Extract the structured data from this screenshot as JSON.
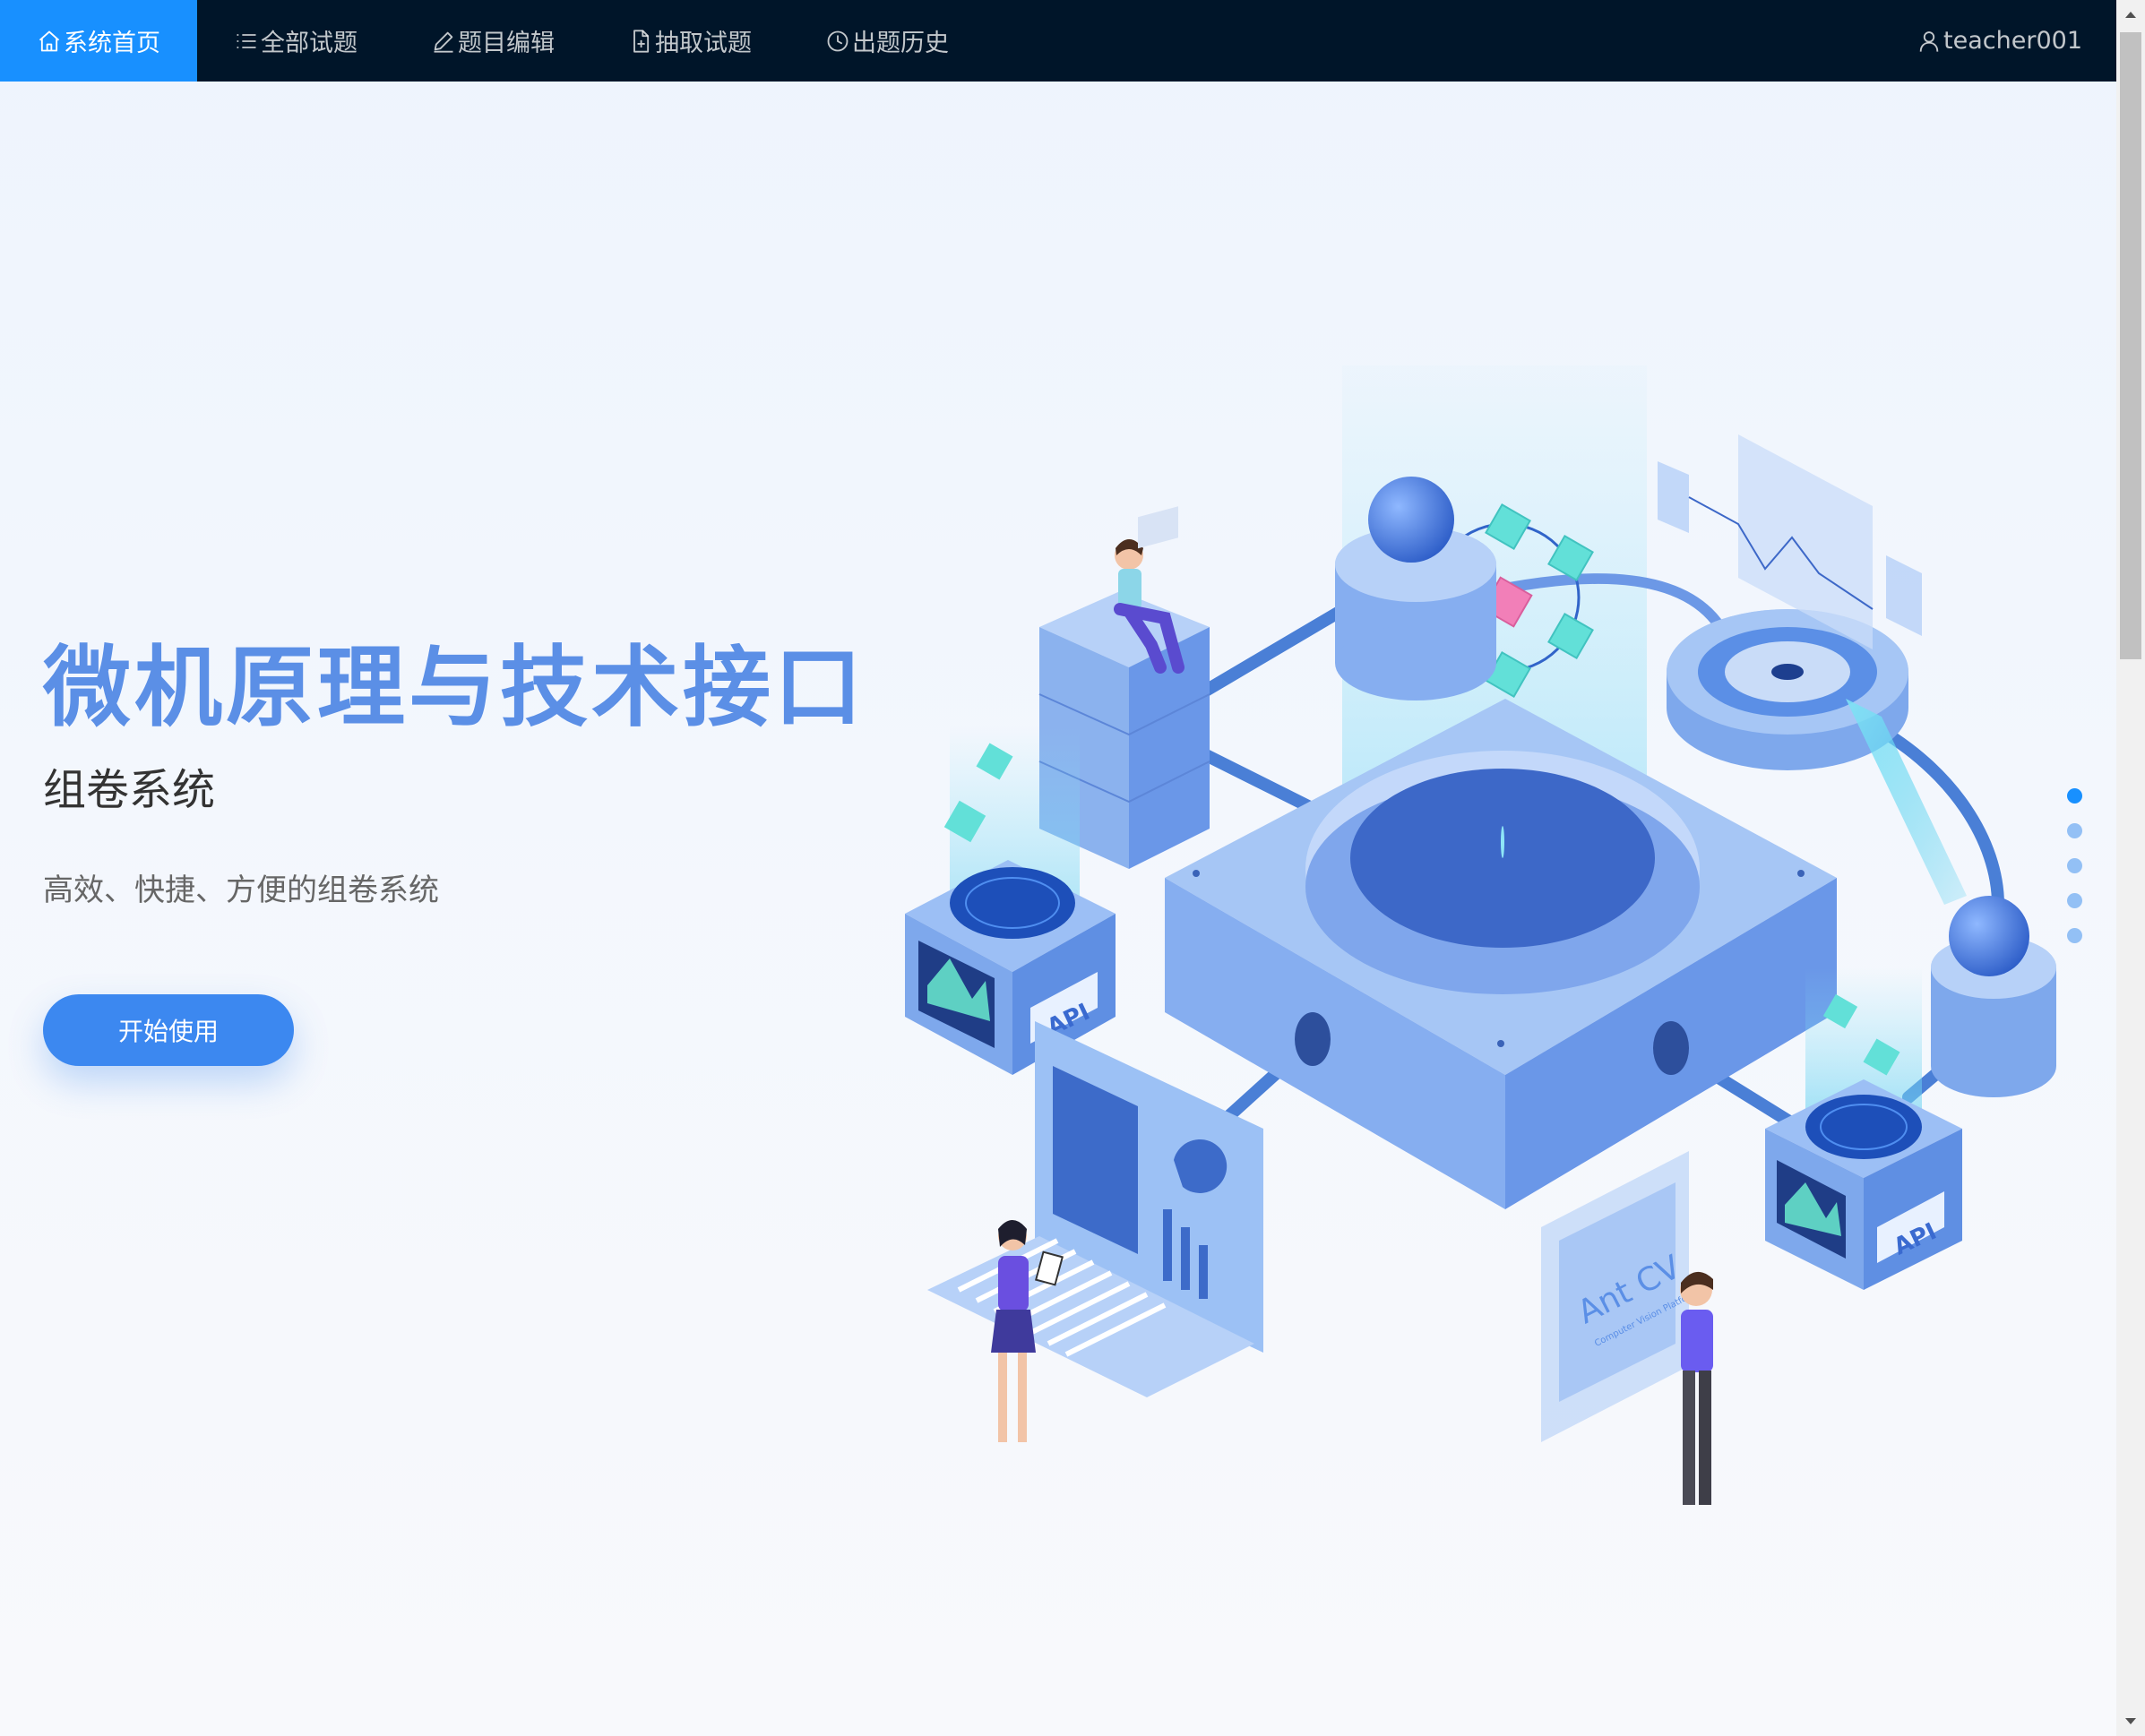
{
  "nav": {
    "items": [
      {
        "label": "系统首页",
        "icon": "home-icon",
        "active": true
      },
      {
        "label": "全部试题",
        "icon": "list-icon",
        "active": false
      },
      {
        "label": "题目编辑",
        "icon": "edit-icon",
        "active": false
      },
      {
        "label": "抽取试题",
        "icon": "file-add-icon",
        "active": false
      },
      {
        "label": "出题历史",
        "icon": "history-icon",
        "active": false
      }
    ],
    "user": {
      "label": "teacher001",
      "icon": "user-icon"
    }
  },
  "hero": {
    "title": "微机原理与技术接口",
    "subtitle": "组卷系统",
    "description": "高效、快捷、方便的组卷系统",
    "start_button": "开始使用"
  },
  "illustration": {
    "icon": "isometric-platform-illustration",
    "labels": {
      "api": "API",
      "antcv": "Ant CV",
      "antcv_sub": "Computer Vision Platform"
    }
  },
  "slides": {
    "count": 5,
    "active": 1
  },
  "colors": {
    "nav_bg": "#001529",
    "nav_active": "#1890ff",
    "title": "#5b8fe6",
    "button": "#3c88f0",
    "dot": "#93c0f5",
    "dot_active": "#1890ff"
  }
}
